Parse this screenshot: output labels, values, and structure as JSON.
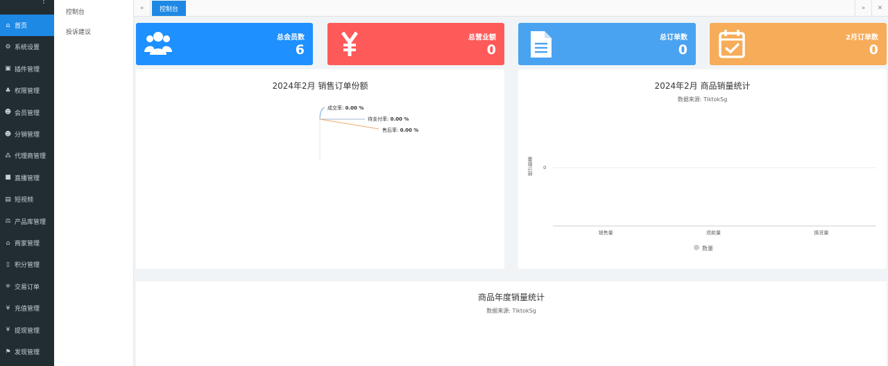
{
  "sidebar": {
    "items": [
      {
        "icon": "home-icon",
        "glyph": "⌂",
        "label": "首页",
        "active": true
      },
      {
        "icon": "gear-icon",
        "glyph": "⚙",
        "label": "系统设置"
      },
      {
        "icon": "plugin-icon",
        "glyph": "▣",
        "label": "插件管理"
      },
      {
        "icon": "sitemap-icon",
        "glyph": "♣",
        "label": "权限管理"
      },
      {
        "icon": "users-icon",
        "glyph": "☻",
        "label": "会员管理"
      },
      {
        "icon": "users-icon",
        "glyph": "☻",
        "label": "分销管理"
      },
      {
        "icon": "cubes-icon",
        "glyph": "⁂",
        "label": "代理商管理"
      },
      {
        "icon": "video-icon",
        "glyph": "■",
        "label": "直播管理"
      },
      {
        "icon": "film-icon",
        "glyph": "▤",
        "label": "短视频"
      },
      {
        "icon": "balance-icon",
        "glyph": "⚖",
        "label": "产品库管理"
      },
      {
        "icon": "bank-icon",
        "glyph": "⌂",
        "label": "商家管理"
      },
      {
        "icon": "document-icon",
        "glyph": "▯",
        "label": "积分管理"
      },
      {
        "icon": "exchange-icon",
        "glyph": "≑",
        "label": "交易订单"
      },
      {
        "icon": "yen-icon",
        "glyph": "¥",
        "label": "充值管理"
      },
      {
        "icon": "yen-icon",
        "glyph": "¥",
        "label": "提现管理"
      },
      {
        "icon": "flag-icon",
        "glyph": "⚑",
        "label": "发现管理"
      }
    ]
  },
  "submenu": {
    "items": [
      "控制台",
      "投诉建议"
    ]
  },
  "tabs": {
    "active": "控制台",
    "left_icon": "«",
    "right_icon": "»",
    "close_icon": "✕"
  },
  "cards": [
    {
      "label": "总会员数",
      "value": "6",
      "color": "#1e90ff",
      "icon": "users-icon"
    },
    {
      "label": "总营业额",
      "value": "0",
      "color": "#ff5a5a",
      "icon": "yen-icon"
    },
    {
      "label": "总订单数",
      "value": "0",
      "color": "#4aa3f0",
      "icon": "document-icon"
    },
    {
      "label": "2月订单数",
      "value": "0",
      "color": "#f7ac59",
      "icon": "calendar-check-icon"
    }
  ],
  "sales_pie": {
    "title": "2024年2月 销售订单份额",
    "labels": [
      {
        "name": "成交率",
        "value": "0.00 %"
      },
      {
        "name": "待支付率",
        "value": "0.00 %"
      },
      {
        "name": "售后率",
        "value": "0.00 %"
      }
    ]
  },
  "product_bar": {
    "title": "2024年2月 商品销量统计",
    "subtitle": "数据来源: TiktokSg",
    "ylabel": "统计数量",
    "ytick": "0",
    "legend": "数量"
  },
  "chart_data": {
    "type": "bar",
    "categories": [
      "销售量",
      "退款量",
      "换货量"
    ],
    "series": [
      {
        "name": "数量",
        "values": [
          0,
          0,
          0
        ]
      }
    ],
    "title": "2024年2月 商品销量统计",
    "subtitle": "数据来源: TiktokSg",
    "ylabel": "统计数量",
    "xlabel": ""
  },
  "annual_panel": {
    "title": "商品年度销量统计",
    "subtitle": "数据来源: TiktokSg"
  }
}
